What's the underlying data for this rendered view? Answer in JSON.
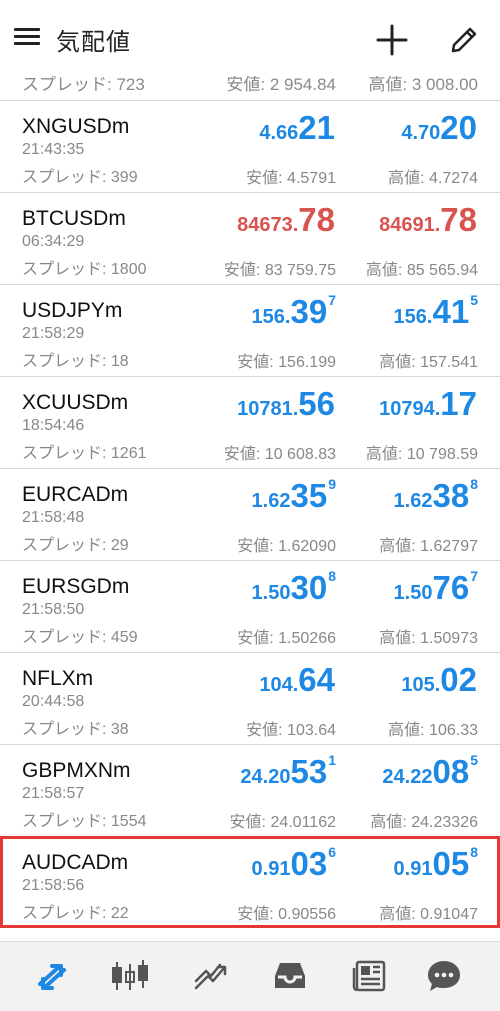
{
  "header": {
    "title": "気配値"
  },
  "partial_row": {
    "spread": "スプレッド: 723",
    "low": "安値: 2 954.84",
    "high": "高値: 3 008.00"
  },
  "quotes": [
    {
      "symbol": "XNGUSDm",
      "time": "21:43:35",
      "spread": "スプレッド: 399",
      "bid": {
        "small": "4.66",
        "big": "21",
        "sup": ""
      },
      "ask": {
        "small": "4.70",
        "big": "20",
        "sup": ""
      },
      "low": "安値: 4.5791",
      "high": "高値: 4.7274",
      "direction": "up",
      "color": "#1e88e5"
    },
    {
      "symbol": "BTCUSDm",
      "time": "06:34:29",
      "spread": "スプレッド: 1800",
      "bid": {
        "small": "84673.",
        "big": "78",
        "sup": ""
      },
      "ask": {
        "small": "84691.",
        "big": "78",
        "sup": ""
      },
      "low": "安値: 83 759.75",
      "high": "高値: 85 565.94",
      "direction": "down",
      "color": "#d9534f"
    },
    {
      "symbol": "USDJPYm",
      "time": "21:58:29",
      "spread": "スプレッド: 18",
      "bid": {
        "small": "156.",
        "big": "39",
        "sup": "7"
      },
      "ask": {
        "small": "156.",
        "big": "41",
        "sup": "5"
      },
      "low": "安値: 156.199",
      "high": "高値: 157.541",
      "direction": "up",
      "color": "#1e88e5"
    },
    {
      "symbol": "XCUUSDm",
      "time": "18:54:46",
      "spread": "スプレッド: 1261",
      "bid": {
        "small": "10781.",
        "big": "56",
        "sup": ""
      },
      "ask": {
        "small": "10794.",
        "big": "17",
        "sup": ""
      },
      "low": "安値: 10 608.83",
      "high": "高値: 10 798.59",
      "direction": "up",
      "color": "#1e88e5"
    },
    {
      "symbol": "EURCADm",
      "time": "21:58:48",
      "spread": "スプレッド: 29",
      "bid": {
        "small": "1.62",
        "big": "35",
        "sup": "9"
      },
      "ask": {
        "small": "1.62",
        "big": "38",
        "sup": "8"
      },
      "low": "安値: 1.62090",
      "high": "高値: 1.62797",
      "direction": "up",
      "color": "#1e88e5"
    },
    {
      "symbol": "EURSGDm",
      "time": "21:58:50",
      "spread": "スプレッド: 459",
      "bid": {
        "small": "1.50",
        "big": "30",
        "sup": "8"
      },
      "ask": {
        "small": "1.50",
        "big": "76",
        "sup": "7"
      },
      "low": "安値: 1.50266",
      "high": "高値: 1.50973",
      "direction": "up",
      "color": "#1e88e5"
    },
    {
      "symbol": "NFLXm",
      "time": "20:44:58",
      "spread": "スプレッド: 38",
      "bid": {
        "small": "104.",
        "big": "64",
        "sup": ""
      },
      "ask": {
        "small": "105.",
        "big": "02",
        "sup": ""
      },
      "low": "安値: 103.64",
      "high": "高値: 106.33",
      "direction": "up",
      "color": "#1e88e5"
    },
    {
      "symbol": "GBPMXNm",
      "time": "21:58:57",
      "spread": "スプレッド: 1554",
      "bid": {
        "small": "24.20",
        "big": "53",
        "sup": "1"
      },
      "ask": {
        "small": "24.22",
        "big": "08",
        "sup": "5"
      },
      "low": "安値: 24.01162",
      "high": "高値: 24.23326",
      "direction": "up",
      "color": "#1e88e5"
    },
    {
      "symbol": "AUDCADm",
      "time": "21:58:56",
      "spread": "スプレッド: 22",
      "bid": {
        "small": "0.91",
        "big": "03",
        "sup": "6"
      },
      "ask": {
        "small": "0.91",
        "big": "05",
        "sup": "8"
      },
      "low": "安値: 0.90556",
      "high": "高値: 0.91047",
      "direction": "up",
      "color": "#1e88e5",
      "selected": true
    }
  ],
  "bottom_nav": [
    {
      "name": "quotes-tab",
      "icon": "quotes-arrows-icon",
      "active": true
    },
    {
      "name": "chart-tab",
      "icon": "candlestick-icon",
      "active": false
    },
    {
      "name": "trade-tab",
      "icon": "trade-trend-icon",
      "active": false
    },
    {
      "name": "history-tab",
      "icon": "inbox-tray-icon",
      "active": false
    },
    {
      "name": "news-tab",
      "icon": "newspaper-icon",
      "active": false
    },
    {
      "name": "chat-tab",
      "icon": "chat-bubble-icon",
      "active": false
    }
  ],
  "colors": {
    "up": "#1e88e5",
    "down": "#d9534f",
    "selection": "#e53935",
    "active_tab": "#1e88e5",
    "inactive_tab": "#555555"
  }
}
